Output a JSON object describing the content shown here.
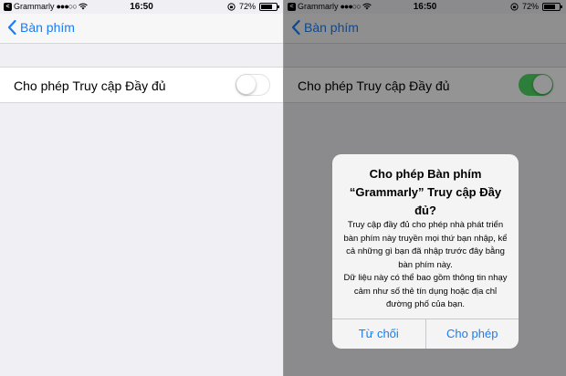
{
  "status_bar": {
    "carrier": "Grammarly",
    "signal": "●●●○○",
    "time": "16:50",
    "battery": "72%",
    "battery_level": 0.72
  },
  "nav": {
    "back_label": "Bàn phím"
  },
  "setting": {
    "label": "Cho phép Truy cập Đầy đủ",
    "left_toggle_on": false,
    "right_toggle_on": true
  },
  "alert": {
    "title": "Cho phép Bàn phím “Grammarly” Truy cập Đầy đủ?",
    "message_1": "Truy cập đầy đủ cho phép nhà phát triển bàn phím này truyền mọi thứ bạn nhập, kể cả những gì bạn đã nhập trước đây bằng bàn phím này.",
    "message_2": "Dữ liệu này có thể bao gồm thông tin nhạy cảm như số thẻ tín dụng hoặc địa chỉ đường phố của bạn.",
    "deny_label": "Từ chối",
    "allow_label": "Cho phép"
  },
  "colors": {
    "accent": "#1a7cf5",
    "toggle_on": "#4cd964",
    "background": "#efeff4"
  }
}
